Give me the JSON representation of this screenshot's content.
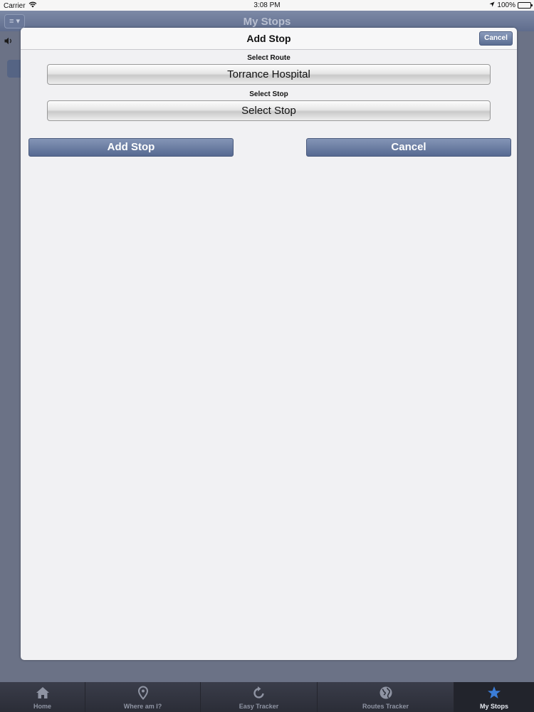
{
  "status_bar": {
    "carrier": "Carrier",
    "time": "3:08 PM",
    "battery": "100%",
    "battery_level": 1.0
  },
  "background": {
    "title": "My Stops",
    "menu_icon": "≡ ▾"
  },
  "modal": {
    "title": "Add Stop",
    "header_cancel_label": "Cancel",
    "route_label": "Select Route",
    "route_value": "Torrance Hospital",
    "stop_label": "Select Stop",
    "stop_value": "Select Stop",
    "add_button_label": "Add Stop",
    "cancel_button_label": "Cancel"
  },
  "tab_bar": {
    "tabs": [
      {
        "label": "Home",
        "icon": "home-icon"
      },
      {
        "label": "Where am I?",
        "icon": "location-pin-icon"
      },
      {
        "label": "Easy Tracker",
        "icon": "refresh-icon"
      },
      {
        "label": "Routes Tracker",
        "icon": "globe-icon"
      },
      {
        "label": "My Stops",
        "icon": "star-icon",
        "active": true
      }
    ]
  },
  "colors": {
    "accent_blue": "#566991",
    "active_tab_icon": "#3b7dd8",
    "tab_bar": "#2b2d37",
    "modal_background": "#f1f1f3"
  }
}
